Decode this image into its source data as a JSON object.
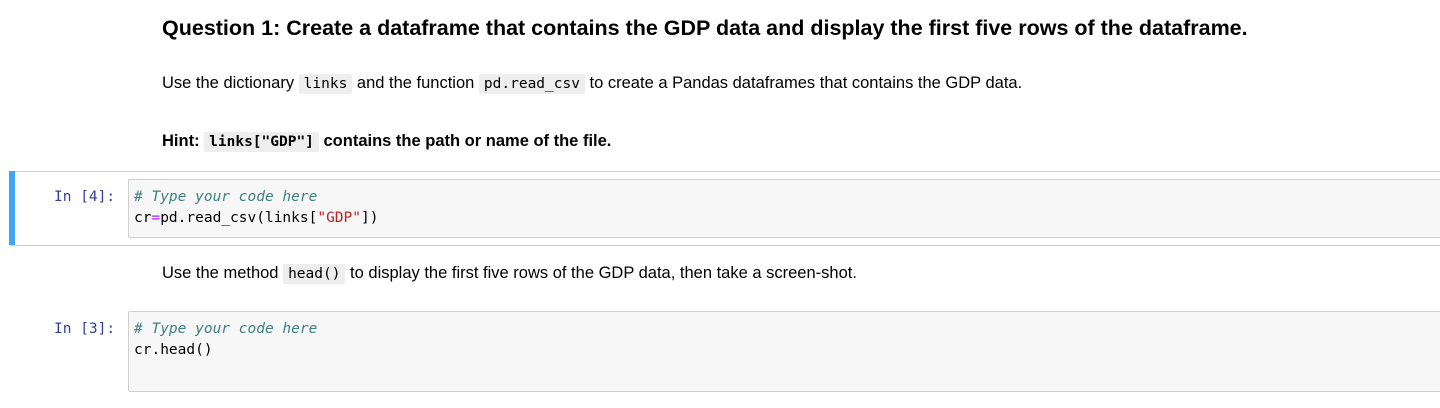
{
  "markdown": {
    "question_title": "Question 1: Create a dataframe that contains the GDP data and display the first five rows of the dataframe.",
    "p1_before": "Use the dictionary ",
    "p1_code1": "links",
    "p1_middle": " and the function ",
    "p1_code2": "pd.read_csv",
    "p1_after": " to create a Pandas dataframes that contains the GDP data.",
    "hint_label": "Hint: ",
    "hint_code": "links[\"GDP\"]",
    "hint_after": " contains the path or name of the file.",
    "p2_before": "Use the method ",
    "p2_code": "head()",
    "p2_after": " to display the first five rows of the GDP data, then take a screen-shot."
  },
  "cells": [
    {
      "prompt": "In [4]:",
      "comment": "# Type your code here",
      "line2_var": "cr",
      "line2_op": "=",
      "line2_call": "pd.read_csv(links[",
      "line2_string": "\"GDP\"",
      "line2_end": "])"
    },
    {
      "prompt": "In [3]:",
      "comment": "# Type your code here",
      "line2": "cr.head()"
    }
  ]
}
